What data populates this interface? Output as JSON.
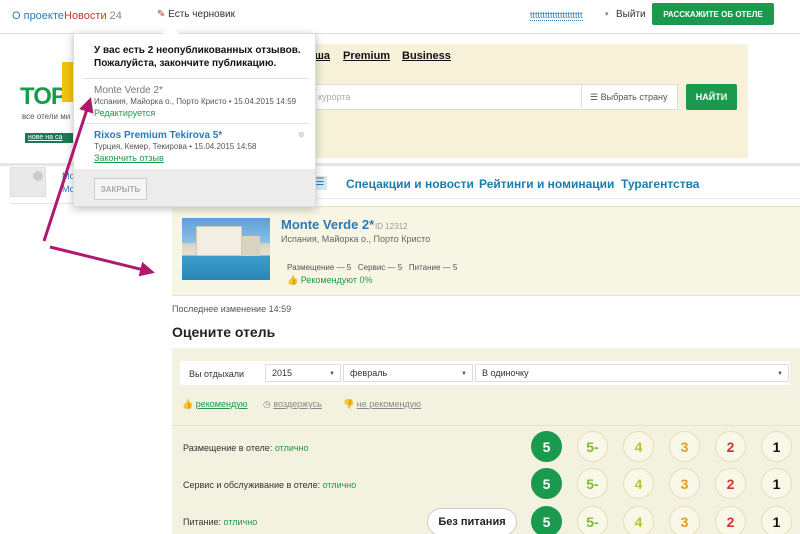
{
  "topbar": {
    "about": "О проекте",
    "news": "Новости",
    "news_count": "24",
    "draft": "Есть черновик",
    "username": "ttttttttttttttttttttt",
    "logout": "Выйти",
    "cta": "РАССКАЖИТЕ ОБ ОТЕЛЕ"
  },
  "header": {
    "links": [
      "Premium",
      "Business"
    ],
    "tagline": "все отели ми",
    "badge": "нове на са",
    "search_placeholder": "курорта",
    "country_select": "Выбрать страну",
    "search_button": "НАЙТИ"
  },
  "sidebar": {
    "line1": "Мой",
    "line2": "Мо"
  },
  "popup": {
    "message": "У вас есть 2 неопубликованных отзывов. Пожалуйста, закончите публикацию.",
    "drafts": [
      {
        "name": "Monte Verde 2*",
        "place": "Испания, Майорка о., Порто Кристо",
        "date": "15.04.2015 14:59",
        "action": "Редактируется"
      },
      {
        "name": "Rixos Premium Tekirova 5*",
        "place": "Турция, Кемер, Текирова",
        "date": "15.04.2015 14:58",
        "action": "Закончить отзыв"
      }
    ],
    "close_button": "ЗАКРЫТЬ"
  },
  "nav": {
    "tabs": [
      "Спецакции и новости",
      "Рейтинги и номинации",
      "Турагентства"
    ]
  },
  "hotel": {
    "name": "Monte Verde 2*",
    "id": "ID 12312",
    "location": "Испания, Майорка о., Порто Кристо",
    "scores": "Размещение — 5   Сервис — 5   Питание — 5",
    "recommend": "Рекомендуют 0%"
  },
  "last_change": "Последнее изменение 14:59",
  "rate": {
    "heading": "Оцените отель",
    "vacation_label": "Вы отдыхали",
    "year": "2015",
    "month": "февраль",
    "company": "В одиночку",
    "recommend": "рекомендую",
    "abstain": "воздержусь",
    "not_recommend": "не рекомендую",
    "rows": [
      {
        "label": "Размещение в отеле:",
        "value": "отлично"
      },
      {
        "label": "Сервис и обслуживание в отеле:",
        "value": "отлично"
      },
      {
        "label": "Питание:",
        "value": "отлично"
      }
    ],
    "no_food": "Без питания",
    "scale": [
      "5",
      "5-",
      "4",
      "3",
      "2",
      "1"
    ]
  },
  "colors": {
    "accent_green": "#1a9a4c",
    "link_blue": "#2b7ab5",
    "arrow": "#b0186e"
  }
}
